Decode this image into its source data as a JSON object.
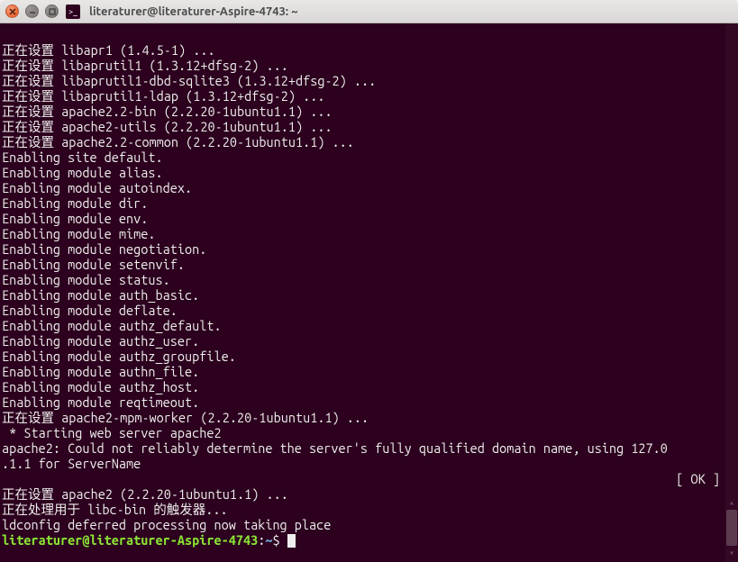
{
  "window": {
    "title": "literaturer@literaturer-Aspire-4743: ~"
  },
  "terminal": {
    "lines": [
      "正在设置 libapr1 (1.4.5-1) ...",
      "正在设置 libaprutil1 (1.3.12+dfsg-2) ...",
      "正在设置 libaprutil1-dbd-sqlite3 (1.3.12+dfsg-2) ...",
      "正在设置 libaprutil1-ldap (1.3.12+dfsg-2) ...",
      "正在设置 apache2.2-bin (2.2.20-1ubuntu1.1) ...",
      "正在设置 apache2-utils (2.2.20-1ubuntu1.1) ...",
      "正在设置 apache2.2-common (2.2.20-1ubuntu1.1) ...",
      "Enabling site default.",
      "Enabling module alias.",
      "Enabling module autoindex.",
      "Enabling module dir.",
      "Enabling module env.",
      "Enabling module mime.",
      "Enabling module negotiation.",
      "Enabling module setenvif.",
      "Enabling module status.",
      "Enabling module auth_basic.",
      "Enabling module deflate.",
      "Enabling module authz_default.",
      "Enabling module authz_user.",
      "Enabling module authz_groupfile.",
      "Enabling module authn_file.",
      "Enabling module authz_host.",
      "Enabling module reqtimeout.",
      "正在设置 apache2-mpm-worker (2.2.20-1ubuntu1.1) ...",
      " * Starting web server apache2",
      "apache2: Could not reliably determine the server's fully qualified domain name, using 127.0",
      ".1.1 for ServerName"
    ],
    "ok_line": "[ OK ]",
    "after_ok_lines": [
      "正在设置 apache2 (2.2.20-1ubuntu1.1) ...",
      "正在处理用于 libc-bin 的触发器...",
      "ldconfig deferred processing now taking place"
    ],
    "prompt": {
      "user_host": "literaturer@literaturer-Aspire-4743",
      "sep1": ":",
      "path": "~",
      "sep2": "$ "
    }
  }
}
